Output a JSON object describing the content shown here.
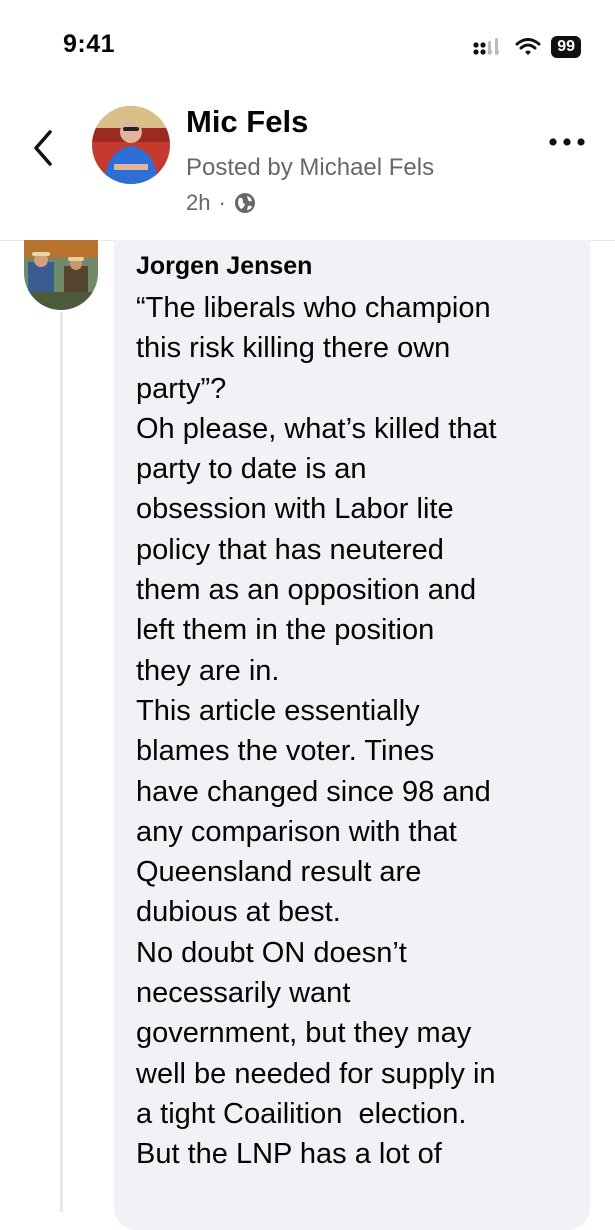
{
  "status_bar": {
    "time": "9:41",
    "battery": "99"
  },
  "post": {
    "author": "Mic Fels",
    "posted_by": "Posted by Michael Fels",
    "time_ago": "2h",
    "separator": "·"
  },
  "comment": {
    "author": "Jorgen Jensen",
    "lines": [
      "“The liberals who champion",
      "this risk killing there own",
      "party”?",
      "Oh please, what’s killed that",
      "party to date is an",
      "obsession with Labor lite",
      "policy that has neutered",
      "them as an opposition and",
      "left them in the position",
      "they are in.",
      "This article essentially",
      "blames the voter. Tines",
      "have changed since 98 and",
      "any comparison with that",
      "Queensland result are",
      "dubious at best.",
      "No doubt ON doesn’t",
      "necessarily want",
      "government, but they may",
      "well be needed for supply in",
      "a tight Coailition  election.",
      "But the LNP has a lot of"
    ]
  },
  "icons": {
    "back": "chevron-left-icon",
    "more": "more-horizontal-icon",
    "privacy": "globe-icon",
    "signal": "cellular-signal-icon",
    "wifi": "wifi-icon",
    "battery": "battery-icon"
  }
}
